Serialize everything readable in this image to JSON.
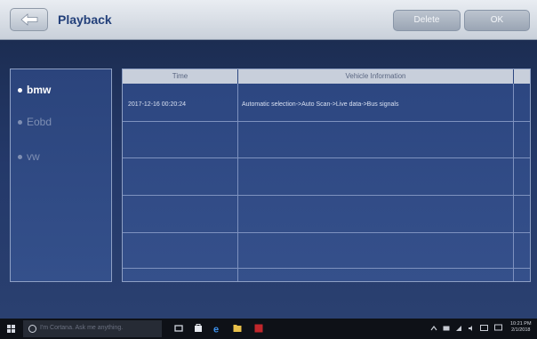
{
  "header": {
    "title": "Playback",
    "delete_label": "Delete",
    "ok_label": "OK"
  },
  "sidebar": {
    "items": [
      {
        "label": "bmw",
        "active": true
      },
      {
        "label": "Eobd",
        "active": false
      },
      {
        "label": "vw",
        "active": false
      }
    ]
  },
  "table": {
    "columns": [
      "Time",
      "Vehicle Information"
    ],
    "rows": [
      {
        "time": "2017-12-16 00:20:24",
        "info": "Automatic selection->Auto Scan->Live data->Bus signals"
      }
    ]
  },
  "taskbar": {
    "search_placeholder": "I'm Cortana. Ask me anything.",
    "clock_time": "10:21 PM",
    "clock_date": "2/1/2018"
  }
}
